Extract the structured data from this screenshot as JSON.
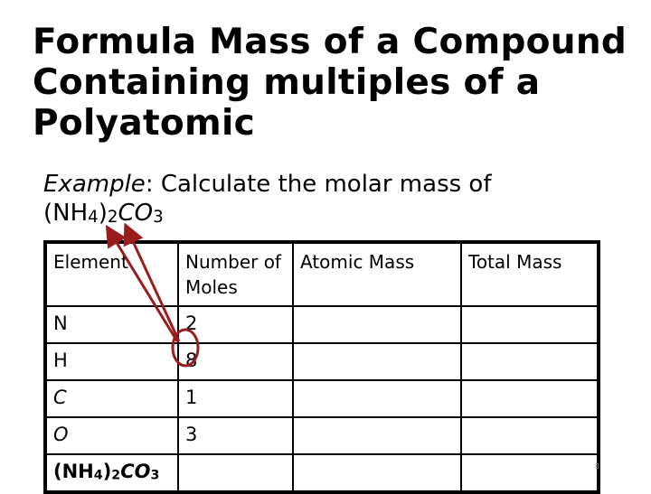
{
  "slide": {
    "title": "Formula Mass of a Compound Containing multiples of a Polyatomic",
    "example_label": "Example",
    "example_text": ": Calculate the molar mass of",
    "formula": {
      "part1": "(NH",
      "sub1": "4",
      "part2": ")",
      "sub2": "2",
      "part3": "CO",
      "sub3": "3"
    },
    "page_number": "8",
    "annotation_color": "#9b1c1c"
  },
  "table": {
    "headers": [
      "Element",
      "Number of Moles",
      "Atomic Mass",
      "Total Mass"
    ],
    "rows": [
      {
        "element": "N",
        "moles": "2",
        "atomic_mass": "",
        "total_mass": ""
      },
      {
        "element": "H",
        "moles": "8",
        "atomic_mass": "",
        "total_mass": ""
      },
      {
        "element": "C",
        "moles": "1",
        "atomic_mass": "",
        "total_mass": ""
      },
      {
        "element": "O",
        "moles": "3",
        "atomic_mass": "",
        "total_mass": ""
      }
    ],
    "total_row": {
      "formula": {
        "part1": "(NH",
        "sub1": "4",
        "part2": ")",
        "sub2": "2",
        "part3": "CO",
        "sub3": "3"
      },
      "moles": "",
      "atomic_mass": "",
      "total_mass": ""
    },
    "highlighted_value": "8"
  }
}
